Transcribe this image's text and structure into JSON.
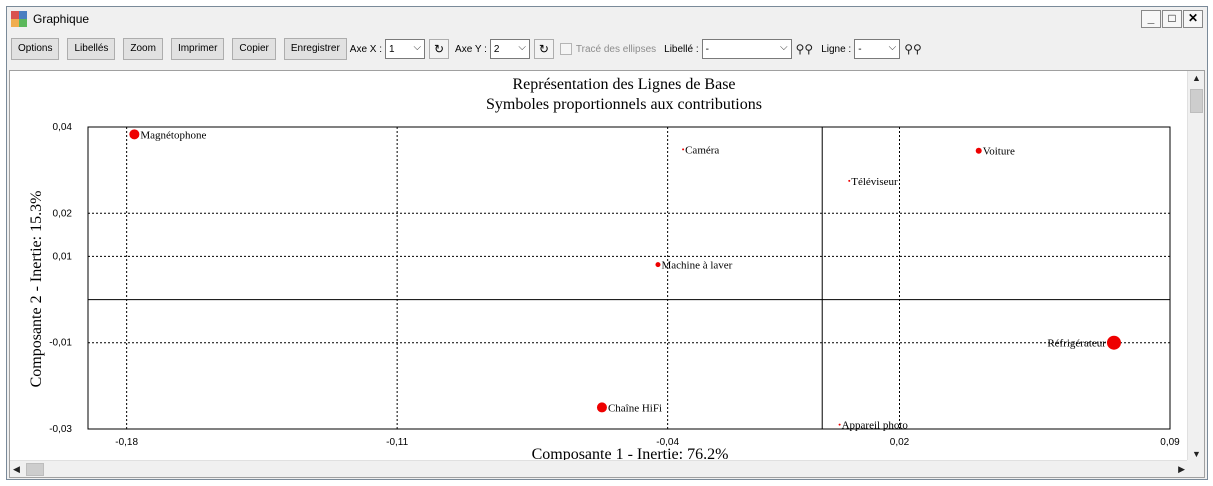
{
  "window": {
    "title": "Graphique"
  },
  "colors": {
    "icon_tl": "#d9534f",
    "icon_tr": "#4a7fc1",
    "icon_bl": "#f0ad4e",
    "icon_br": "#5cb85c",
    "point": "#ee0000"
  },
  "toolbar": {
    "options": "Options",
    "labels": "Libellés",
    "zoom": "Zoom",
    "print": "Imprimer",
    "copy": "Copier",
    "save": "Enregistrer",
    "axis_x_label": "Axe X :",
    "axis_x_value": "1",
    "axis_y_label": "Axe Y :",
    "axis_y_value": "2",
    "ellipses_label": "Tracé des ellipses",
    "libelle_label": "Libellé :",
    "libelle_value": "-",
    "ligne_label": "Ligne :",
    "ligne_value": "-"
  },
  "chart_data": {
    "type": "scatter",
    "title": "Représentation des Lignes de Base",
    "subtitle": "Symboles proportionnels aux contributions",
    "xlabel": "Composante 1 - Inertie:  76.2%",
    "ylabel": "Composante 2 - Inertie:  15.3%",
    "xlim": [
      -0.19,
      0.09
    ],
    "ylim": [
      -0.03,
      0.04
    ],
    "xticks": [
      "-0,18",
      "-0,11",
      "-0,04",
      "0,02",
      "0,09"
    ],
    "xtick_values": [
      -0.18,
      -0.11,
      -0.04,
      0.02,
      0.09
    ],
    "yticks": [
      "0,04",
      "0,02",
      "0,01",
      "-0,01",
      "-0,03"
    ],
    "ytick_values": [
      0.04,
      0.02,
      0.01,
      -0.01,
      -0.03
    ],
    "grid": true,
    "points": [
      {
        "label": "Magnétophone",
        "x": -0.178,
        "y": 0.0383,
        "size": 5
      },
      {
        "label": "Caméra",
        "x": -0.036,
        "y": 0.0348,
        "size": 1
      },
      {
        "label": "Voiture",
        "x": 0.0405,
        "y": 0.0345,
        "size": 3
      },
      {
        "label": "Téléviseur",
        "x": 0.007,
        "y": 0.0275,
        "size": 1
      },
      {
        "label": "Machine à laver",
        "x": -0.0425,
        "y": 0.0081,
        "size": 2.5
      },
      {
        "label": "Réfrigérateur",
        "x": 0.0755,
        "y": -0.01,
        "size": 7
      },
      {
        "label": "Chaîne HiFi",
        "x": -0.057,
        "y": -0.025,
        "size": 5
      },
      {
        "label": "Appareil photo",
        "x": 0.0045,
        "y": -0.029,
        "size": 1
      }
    ]
  }
}
